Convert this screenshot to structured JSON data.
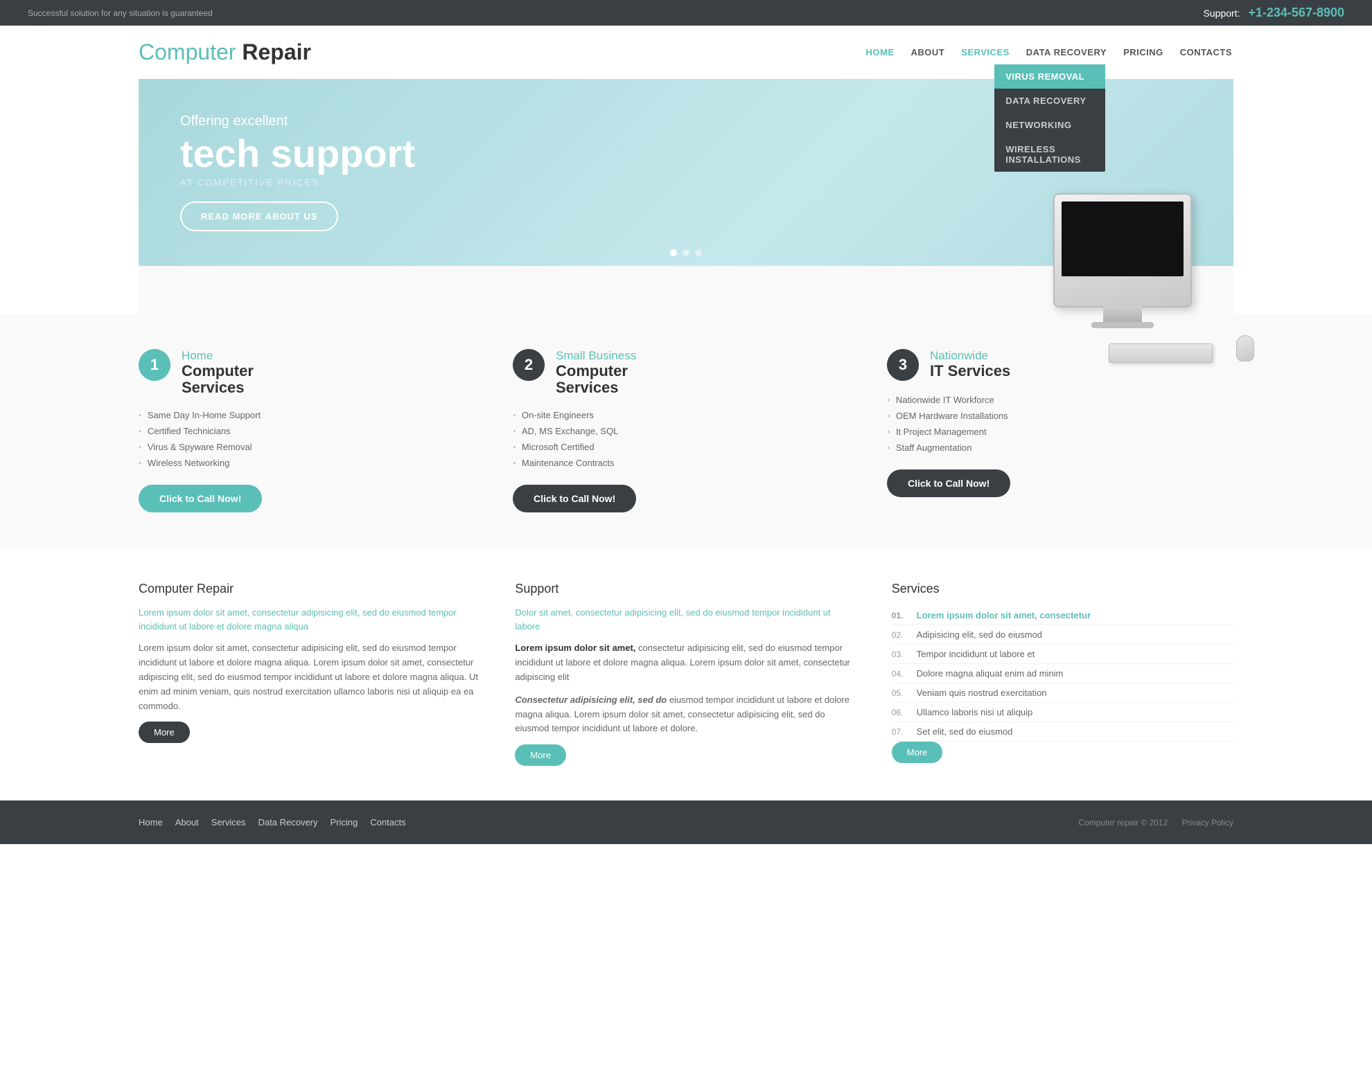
{
  "topbar": {
    "tagline": "Successful solution for any situation is guaranteed",
    "support_label": "Support:",
    "phone": "+1-234-567-8900"
  },
  "header": {
    "logo_computer": "Computer",
    "logo_repair": "Repair",
    "nav": [
      {
        "label": "HOME",
        "active": true
      },
      {
        "label": "ABOUT",
        "active": false
      },
      {
        "label": "SERVICES",
        "active": false,
        "has_dropdown": true
      },
      {
        "label": "DATA RECOVERY",
        "active": false
      },
      {
        "label": "PRICING",
        "active": false
      },
      {
        "label": "CONTACTS",
        "active": false
      }
    ],
    "dropdown": [
      {
        "label": "Virus Removal",
        "active": true
      },
      {
        "label": "Data Recovery",
        "active": false
      },
      {
        "label": "Networking",
        "active": false
      },
      {
        "label": "Wireless Installations",
        "active": false
      }
    ]
  },
  "hero": {
    "subtitle": "Offering excellent",
    "title": "tech support",
    "tagline": "AT COMPETITIVE PRICES",
    "button": "READ MORE ABOUT US",
    "dots": 3
  },
  "services": {
    "card1": {
      "number": "1",
      "subtitle": "Home",
      "title": "Computer\nServices",
      "items": [
        "Same Day In-Home Support",
        "Certified Technicians",
        "Virus & Spyware Removal",
        "Wireless Networking"
      ],
      "cta": "Click to Call Now!",
      "style": "teal"
    },
    "card2": {
      "number": "2",
      "subtitle": "Small Business",
      "title": "Computer\nServices",
      "items": [
        "On-site Engineers",
        "AD, MS Exchange, SQL",
        "Microsoft Certified",
        "Maintenance Contracts"
      ],
      "cta": "Click to Call Now!",
      "style": "dark"
    },
    "card3": {
      "number": "3",
      "subtitle": "Nationwide",
      "title": "IT Services",
      "items": [
        "Nationwide IT Workforce",
        "OEM Hardware Installations",
        "It Project Management",
        "Staff Augmentation"
      ],
      "cta": "Click to Call Now!",
      "style": "dark"
    }
  },
  "info": {
    "col1": {
      "heading": "Computer Repair",
      "highlight": "Lorem ipsum dolor sit amet, consectetur adipisicing elit, sed do eiusmod tempor incididunt ut labore et dolore magna aliqua",
      "body": "Lorem ipsum dolor sit amet, consectetur adipisicing elit, sed do eiusmod tempor incididunt ut labore et dolore magna aliqua. Lorem ipsum dolor sit amet, consectetur adipiscing elit, sed do eiusmod tempor incididunt ut labore et dolore magna aliqua. Ut enim ad minim veniam, quis nostrud exercitation ullamco laboris nisi ut aliquip ea ea commodo.",
      "more": "More"
    },
    "col2": {
      "heading": "Support",
      "highlight": "Dolor sit amet, consectetur adipisicing elit, sed do eiusmod tempor incididunt ut labore",
      "body1_bold": "Lorem ipsum dolor sit amet,",
      "body1": " consectetur adipisicing elit, sed do eiusmod tempor incididunt ut labore et dolore magna aliqua. Lorem ipsum dolor sit amet, consectetur adipiscing elit",
      "body2_em": "Consectetur adipisicing elit, sed do",
      "body2": " eiusmod tempor incididunt ut labore et dolore magna aliqua. Lorem ipsum dolor sit amet, consectetur adipisicing elit, sed do eiusmod tempor incididunt ut labore et dolore.",
      "more": "More"
    },
    "col3": {
      "heading": "Services",
      "items": [
        {
          "label": "Lorem ipsum dolor sit amet, consectetur",
          "highlighted": true
        },
        {
          "label": "Adipisicing elit, sed do eiusmod",
          "highlighted": false
        },
        {
          "label": "Tempor incididunt ut labore et",
          "highlighted": false
        },
        {
          "label": "Dolore magna aliquat enim ad minim",
          "highlighted": false
        },
        {
          "label": "Veniam quis nostrud exercitation",
          "highlighted": false
        },
        {
          "label": "Ullamco laboris nisi ut aliquip",
          "highlighted": false
        },
        {
          "label": "Set elit, sed do eiusmod",
          "highlighted": false
        }
      ],
      "more": "More"
    }
  },
  "footer": {
    "nav": [
      "Home",
      "About",
      "Services",
      "Data Recovery",
      "Pricing",
      "Contacts"
    ],
    "copy": "Computer repair © 2012",
    "privacy": "Privacy Policy"
  }
}
